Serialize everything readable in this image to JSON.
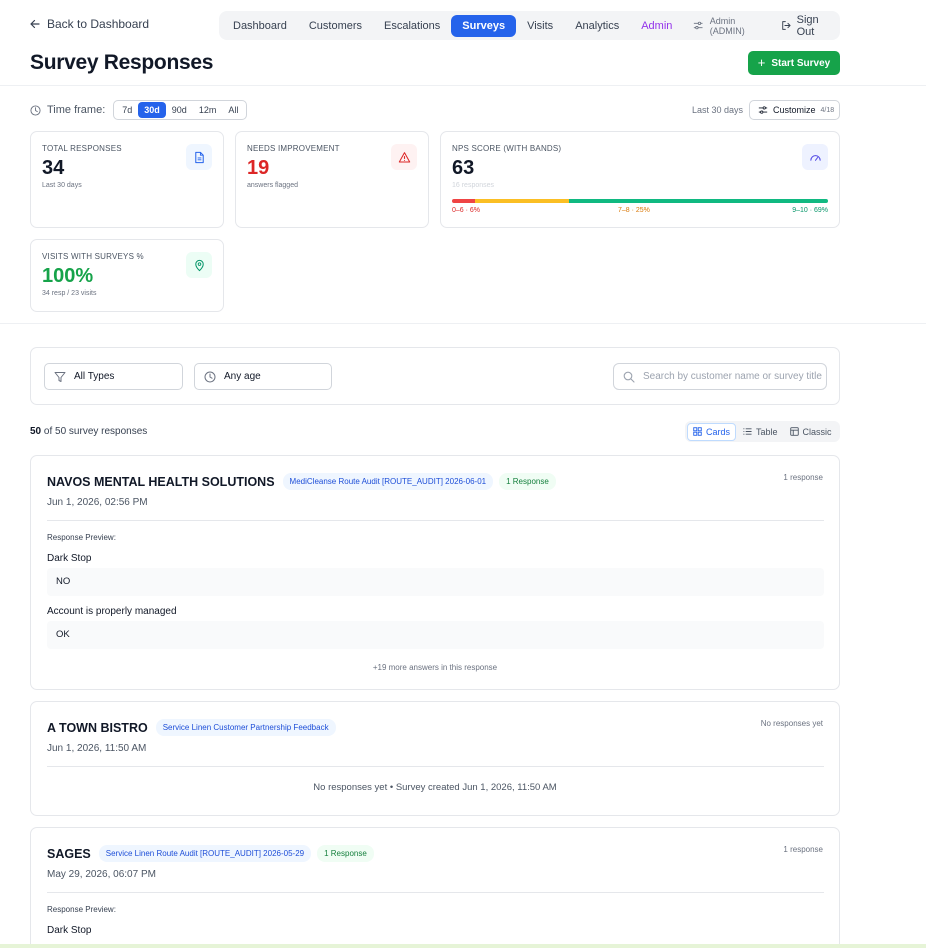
{
  "header": {
    "back_label": "Back to Dashboard",
    "title": "Survey Responses",
    "start_button": "Start Survey",
    "nav": {
      "items": [
        "Dashboard",
        "Customers",
        "Escalations",
        "Surveys",
        "Visits",
        "Analytics",
        "Admin"
      ],
      "active": "Surveys",
      "user": "Admin (ADMIN)",
      "sign_out": "Sign Out"
    }
  },
  "timeframe": {
    "label": "Time frame:",
    "options": [
      "7d",
      "30d",
      "90d",
      "12m",
      "All"
    ],
    "selected": "30d",
    "range_text": "Last 30 days",
    "customize_label": "Customize",
    "customize_count": "4/18"
  },
  "stats": {
    "total": {
      "label": "TOTAL RESPONSES",
      "value": "34",
      "sub": "Last 30 days"
    },
    "needs": {
      "label": "NEEDS IMPROVEMENT",
      "value": "19",
      "sub": "answers flagged"
    },
    "nps": {
      "label": "NPS SCORE (WITH BANDS)",
      "value": "63",
      "sub": "16 responses",
      "bands": [
        {
          "label": "0–6 · 6%",
          "pct": 6,
          "color": "#ef4444"
        },
        {
          "label": "7–8 · 25%",
          "pct": 25,
          "color": "#fbbf24"
        },
        {
          "label": "9–10 · 69%",
          "pct": 69,
          "color": "#10b981"
        }
      ]
    },
    "visits": {
      "label": "VISITS WITH SURVEYS %",
      "value": "100%",
      "sub": "34 resp / 23 visits"
    }
  },
  "filters": {
    "type_value": "All Types",
    "age_value": "Any age",
    "search_placeholder": "Search by customer name or survey title"
  },
  "results": {
    "shown": "50",
    "rest": "of 50 survey responses",
    "views": [
      "Cards",
      "Table",
      "Classic"
    ],
    "active_view": "Cards"
  },
  "responses": [
    {
      "customer": "NAVOS MENTAL HEALTH SOLUTIONS",
      "survey": "MediCleanse Route Audit [ROUTE_AUDIT] 2026-06-01",
      "badge": "1 Response",
      "count_text": "1 response",
      "date": "Jun 1, 2026, 02:56 PM",
      "preview_label": "Response Preview:",
      "answers": [
        {
          "q": "Dark Stop",
          "a": "NO"
        },
        {
          "q": "Account is properly managed",
          "a": "OK"
        }
      ],
      "more": "+19 more answers in this response"
    },
    {
      "customer": "A TOWN BISTRO",
      "survey": "Service Linen Customer Partnership Feedback",
      "count_text": "No responses yet",
      "date": "Jun 1, 2026, 11:50 AM",
      "empty_text": "No responses yet • Survey created Jun 1, 2026, 11:50 AM"
    },
    {
      "customer": "SAGES",
      "survey": "Service Linen Route Audit [ROUTE_AUDIT] 2026-05-29",
      "badge": "1 Response",
      "count_text": "1 response",
      "date": "May 29, 2026, 06:07 PM",
      "preview_label": "Response Preview:",
      "answers": [
        {
          "q": "Dark Stop",
          "a": ""
        }
      ]
    }
  ],
  "colors": {
    "primary": "#2563eb",
    "success": "#16a34a",
    "danger": "#dc2626",
    "admin": "#9333ea"
  }
}
